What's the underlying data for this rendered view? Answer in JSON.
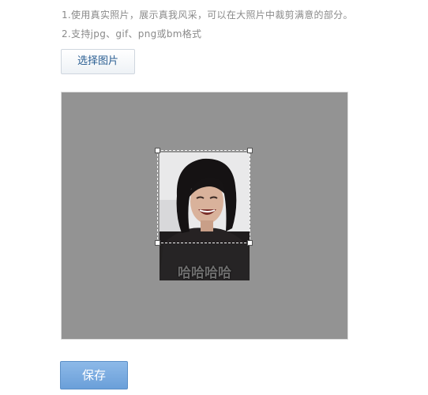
{
  "tips": {
    "line1": "1.使用真实照片，展示真我风采，可以在大照片中裁剪满意的部分。",
    "line2": "2.支持jpg、gif、png或bm格式"
  },
  "buttons": {
    "choose_label": "选择图片",
    "save_label": "保存"
  },
  "photo": {
    "caption": "哈哈哈哈"
  },
  "colors": {
    "crop_background": "#939393",
    "save_button": "#6a9fd9",
    "choose_button_text": "#2b5f93"
  }
}
